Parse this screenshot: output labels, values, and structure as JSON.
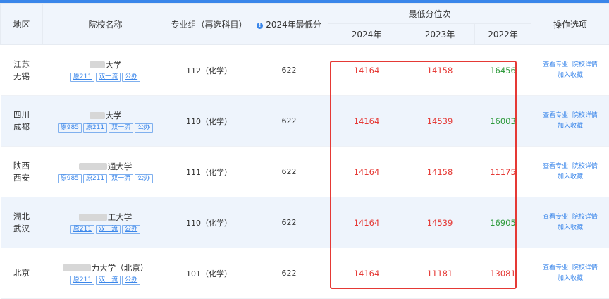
{
  "header": {
    "region": "地区",
    "school": "院校名称",
    "group": "专业组（再选科目）",
    "min_score_2024": "2024年最低分",
    "rank_group": "最低分位次",
    "year_2024": "2024年",
    "year_2023": "2023年",
    "year_2022": "2022年",
    "actions": "操作选项"
  },
  "actions": {
    "view_major": "查看专业",
    "school_detail": "院校详情",
    "add_fav": "加入收藏"
  },
  "rows": [
    {
      "region1": "江苏",
      "region2": "无锡",
      "name": "大学",
      "tags": [
        "原211",
        "双一流",
        "公办"
      ],
      "group": "112（化学）",
      "score": "622",
      "r2024": "14164",
      "r2023": "14158",
      "r2022": "16456"
    },
    {
      "region1": "四川",
      "region2": "成都",
      "name": "大学",
      "tags": [
        "原985",
        "原211",
        "双一流",
        "公办"
      ],
      "group": "110（化学）",
      "score": "622",
      "r2024": "14164",
      "r2023": "14539",
      "r2022": "16003"
    },
    {
      "region1": "陕西",
      "region2": "西安",
      "name": "通大学",
      "tags": [
        "原985",
        "原211",
        "双一流",
        "公办"
      ],
      "group": "111（化学）",
      "score": "622",
      "r2024": "14164",
      "r2023": "14158",
      "r2022": "11175"
    },
    {
      "region1": "湖北",
      "region2": "武汉",
      "name": "工大学",
      "tags": [
        "原211",
        "双一流",
        "公办"
      ],
      "group": "110（化学）",
      "score": "622",
      "r2024": "14164",
      "r2023": "14539",
      "r2022": "16905"
    },
    {
      "region1": "北京",
      "region2": "",
      "name": "力大学（北京）",
      "tags": [
        "原211",
        "双一流",
        "公办"
      ],
      "group": "101（化学）",
      "score": "622",
      "r2024": "14164",
      "r2023": "11181",
      "r2022": "13081"
    }
  ],
  "colors": {
    "accent": "#3a86ea",
    "rank_red": "#e53935",
    "rank_green": "#2e9a3c"
  }
}
